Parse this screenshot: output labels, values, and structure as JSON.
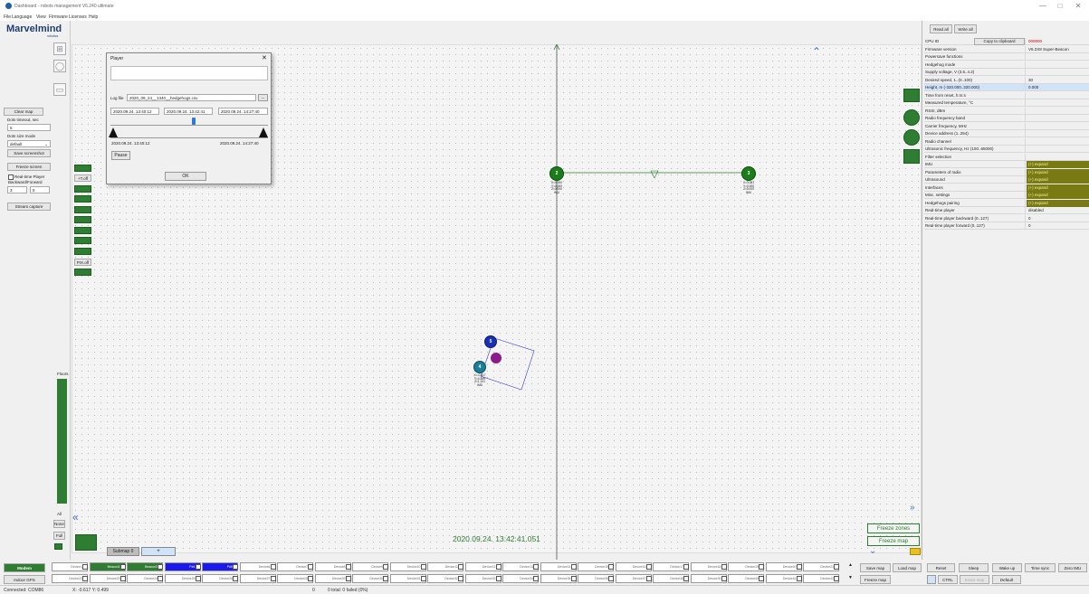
{
  "window": {
    "title": "Dashboard - robots management  V6.240 ultimate",
    "controls": [
      "—",
      "□",
      "✕"
    ]
  },
  "menu": [
    "File",
    "Language",
    "View",
    "Firmware",
    "Licenses",
    "Help"
  ],
  "logo": {
    "text": "Marvelmind",
    "subtext": "robotics"
  },
  "left_panel": {
    "clear_map": "Clear map",
    "dots_timeout_label": "Dots timeout, sec",
    "dots_timeout_value": "5",
    "dots_size_label": "Dots size mode",
    "dots_size_value": "default",
    "save_screenshot": "Save screenshot",
    "freeze_screen": "Freeze screen",
    "realtime_player_label": "Real-time Player",
    "backward_forward_label": "Backward/Forward",
    "backward_value": "3",
    "forward_value": "5",
    "stream_capture": "Stream capture",
    "floors_label": "Floors",
    "all_label": "All",
    "none_label": "None",
    "full_label": "Full"
  },
  "map_side_buttons": [
    "+T.off",
    "PIX.off"
  ],
  "player": {
    "title": "Player",
    "close": "✕",
    "log_file_label": "Log file",
    "log_file_value": "2020_09_24__1340__hedgehogs.csv",
    "browse": "...",
    "start_time": "2020.09.24. 13:40:12",
    "current_time": "2020.09.24. 13:42:41",
    "end_time": "2020.09.24. 14:27:40",
    "range_start": "2020.09.24. 13:40:12",
    "range_end": "2020.09.24. 14:27:40",
    "pause": "Pause",
    "ok": "OK",
    "slider_position": 0.53
  },
  "beacons": [
    {
      "id": "2",
      "info": [
        "X=0.000",
        "Y=0.000",
        "Z=0.000",
        "IMU"
      ]
    },
    {
      "id": "3",
      "info": [
        "X=3.081",
        "Y=0.000",
        "Z=0.000",
        "IMU"
      ]
    },
    {
      "id": "5",
      "info": []
    },
    {
      "id": "4",
      "info": [
        "X=-0.617",
        "Y=0.499",
        "Z=1.101",
        "IMU"
      ]
    }
  ],
  "map_timestamp": "2020.09.24. 13:42:41.051",
  "freeze_zones": "Freeze zones",
  "freeze_map": "Freeze map",
  "submap": {
    "tab": "Submap 0",
    "add": "+"
  },
  "right_panel": {
    "read_all": "Read all",
    "write_all": "Write all",
    "properties": [
      {
        "k": "CPU ID",
        "v": "000000",
        "copy": "Copy to clipboard"
      },
      {
        "k": "Firmware version",
        "v": "V6.2X8 Super-Beacon"
      },
      {
        "k": "Powersave functions",
        "v": ""
      },
      {
        "k": "Hedgehog mode",
        "v": ""
      },
      {
        "k": "Supply voltage, V (3.5..4.2)",
        "v": ""
      },
      {
        "k": "Desired speed, 1..(0..100)",
        "v": "30"
      },
      {
        "k": "Height, m (-320.000..320.000)",
        "v": "0.000"
      },
      {
        "k": "Time from reset, h:m:s",
        "v": ""
      },
      {
        "k": "Measured temperature, °C",
        "v": ""
      },
      {
        "k": "RSSI, dBm",
        "v": ""
      },
      {
        "k": "Radio frequency band",
        "v": ""
      },
      {
        "k": "Carrier frequency, MHz",
        "v": ""
      },
      {
        "k": "Device address (1..254)",
        "v": ""
      },
      {
        "k": "Radio channel",
        "v": ""
      },
      {
        "k": "Ultrasonic frequency, Hz (100..65000)",
        "v": ""
      },
      {
        "k": "Filter selection",
        "v": ""
      },
      {
        "k": "IMU",
        "v": "(+) expand",
        "expand": true
      },
      {
        "k": "Parameters of radio",
        "v": "(+) expand",
        "expand": true
      },
      {
        "k": "Ultrasound",
        "v": "(+) expand",
        "expand": true
      },
      {
        "k": "Interfaces",
        "v": "(+) expand",
        "expand": true
      },
      {
        "k": "Misc. settings",
        "v": "(+) expand",
        "expand": true
      },
      {
        "k": "Hedgehogs pairing",
        "v": "(+) expand",
        "expand": true
      },
      {
        "k": "Real-time player",
        "v": "disabled"
      },
      {
        "k": "Real-time player backward (0..127)",
        "v": "0"
      },
      {
        "k": "Real-time player forward (0..127)",
        "v": "0"
      }
    ]
  },
  "bottom": {
    "modem": "Modem",
    "indoor_gps": "Indoor GPS",
    "row1": [
      "Device1",
      "Beacon2",
      "Beacon3",
      "P#4",
      "P#5",
      "Device6",
      "Device7",
      "Device8",
      "Device9",
      "Device10",
      "Device11",
      "Device12",
      "Device13",
      "Device14",
      "Device15",
      "Device16",
      "Device17",
      "Device18",
      "Device19",
      "Device20",
      "Device21"
    ],
    "row2": [
      "Device22",
      "Device23",
      "Device24",
      "Device25",
      "Device26",
      "Device27",
      "Device28",
      "Device29",
      "Device30",
      "Device31",
      "Device32",
      "Device33",
      "Device34",
      "Device35",
      "Device36",
      "Device37",
      "Device38",
      "Device39",
      "Device40",
      "Device41",
      "Device42"
    ],
    "save_map": "Save map",
    "load_map": "Load map",
    "freeze_map": "Freeze map",
    "reset": "Reset",
    "sleep": "Sleep",
    "wake_up": "Wake up",
    "time_sync": "Time sync",
    "zero_imu": "Zero IMU",
    "ctrl": "CTRL",
    "erase_map": "Erase map",
    "default": "Default"
  },
  "status": {
    "connection": "Connected: COM86",
    "coords": "X: -0.617  Y: 0.499",
    "count": "0",
    "packets": "0 total: 0 failed (0%)"
  }
}
